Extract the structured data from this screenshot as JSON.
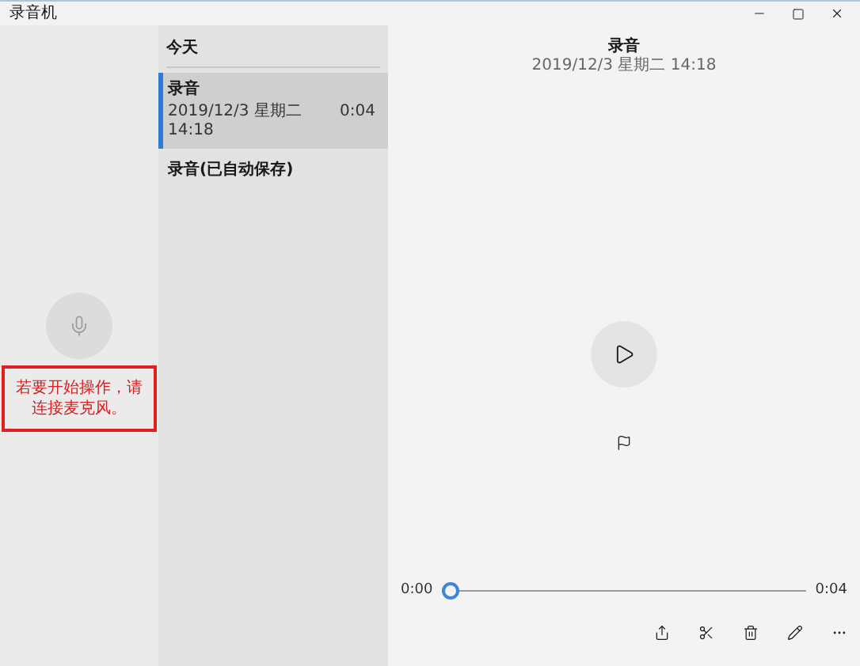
{
  "window": {
    "title": "录音机"
  },
  "recorder": {
    "message": "若要开始操作，请连接麦克风。"
  },
  "list": {
    "heading": "今天",
    "items": [
      {
        "title": "录音",
        "date": "2019/12/3 星期二 14:18",
        "duration": "0:04",
        "selected": true
      },
      {
        "title": "录音(已自动保存)",
        "selected": false
      }
    ]
  },
  "player": {
    "title": "录音",
    "date": "2019/12/3 星期二 14:18",
    "start": "0:00",
    "end": "0:04",
    "level": 0
  }
}
